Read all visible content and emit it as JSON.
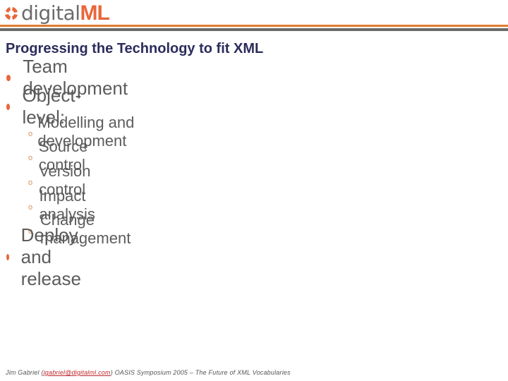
{
  "header": {
    "logo_text_primary": "digital",
    "logo_text_accent": "ML",
    "brand_colors": {
      "orange": "#e8663a",
      "gray": "#6b6b6b",
      "rule_orange": "#e07a2e",
      "rule_gray": "#6a6a66"
    }
  },
  "slide": {
    "title": "Progressing the Technology to fit XML",
    "bullets": [
      {
        "icon": "bullet-dot-icon",
        "text": "Team development"
      },
      {
        "icon": "bullet-dot-icon",
        "text": "Object-level:",
        "subitems": [
          {
            "icon": "bullet-circle-icon",
            "text": "Modelling and development"
          },
          {
            "icon": "bullet-circle-icon",
            "text": "Source control"
          },
          {
            "icon": "bullet-circle-icon",
            "text": "Version control"
          },
          {
            "icon": "bullet-circle-icon",
            "text": "Impact analysis"
          },
          {
            "icon": "bullet-circle-icon",
            "text": "Change management"
          }
        ]
      },
      {
        "icon": "bullet-dot-icon",
        "text": "Deploy and release"
      }
    ],
    "sub_bullet_glyph": "o"
  },
  "footer": {
    "author_prefix": "Jim Gabriel (",
    "email": "jgabriel@digitalml.com",
    "suffix": ") OASIS Symposium 2005 – The Future of XML Vocabularies"
  }
}
